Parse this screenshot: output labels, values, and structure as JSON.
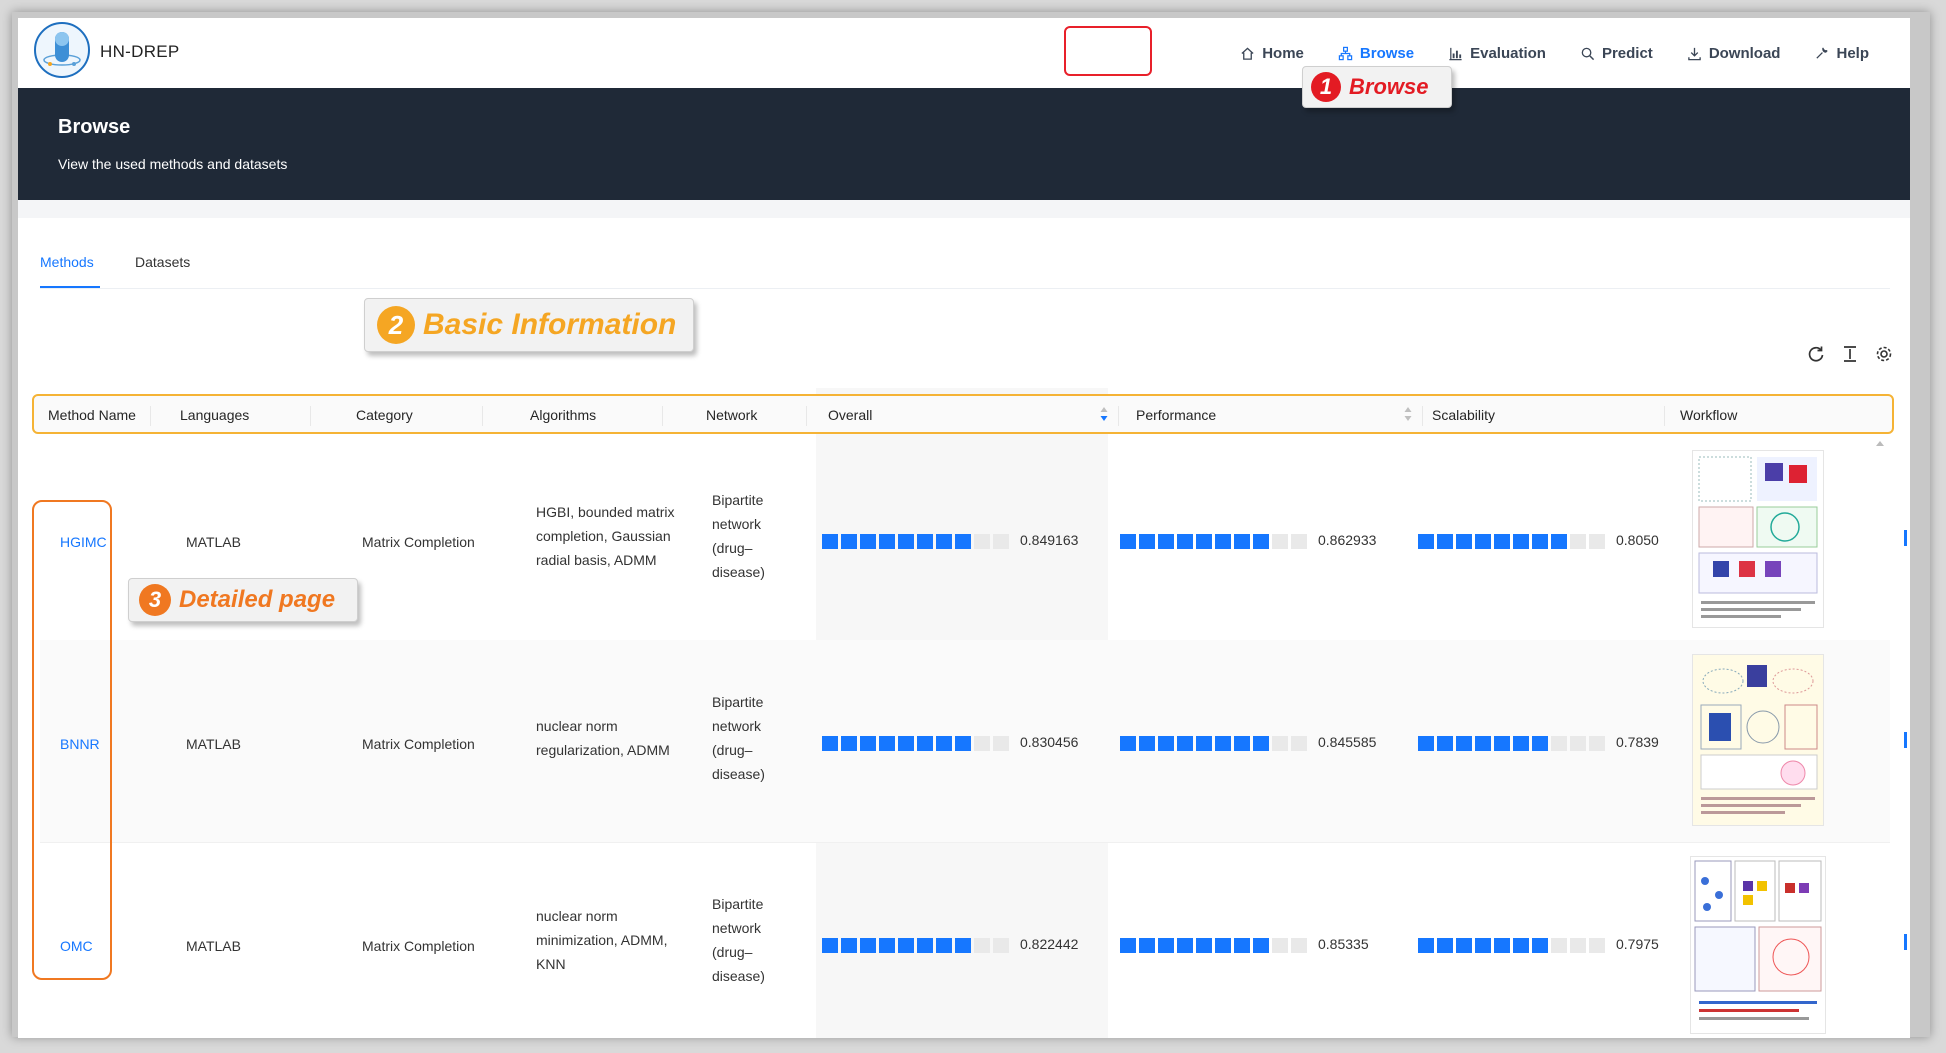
{
  "app": {
    "name": "HN-DREP"
  },
  "nav": [
    {
      "label": "Home",
      "icon": "home-icon"
    },
    {
      "label": "Browse",
      "icon": "sitemap-icon",
      "active": true
    },
    {
      "label": "Evaluation",
      "icon": "bar-chart-icon"
    },
    {
      "label": "Predict",
      "icon": "search-icon"
    },
    {
      "label": "Download",
      "icon": "download-icon"
    },
    {
      "label": "Help",
      "icon": "tool-icon"
    }
  ],
  "hero": {
    "title": "Browse",
    "subtitle": "View the used methods and datasets"
  },
  "callouts": [
    {
      "number": "1",
      "text": "Browse"
    },
    {
      "number": "2",
      "text": "Basic Information"
    },
    {
      "number": "3",
      "text": "Detailed page"
    }
  ],
  "tabs": [
    {
      "label": "Methods",
      "active": true
    },
    {
      "label": "Datasets"
    }
  ],
  "table": {
    "columns": [
      "Method Name",
      "Languages",
      "Category",
      "Algorithms",
      "Network",
      "Overall",
      "Performance",
      "Scalability",
      "Workflow"
    ],
    "rows": [
      {
        "name": "HGIMC",
        "language": "MATLAB",
        "category": "Matrix Completion",
        "algorithms": [
          "HGBI, bounded matrix",
          "completion, Gaussian",
          "radial basis, ADMM"
        ],
        "network": [
          "Bipartite",
          "network",
          "(drug–",
          "disease)"
        ],
        "overall": "0.849163",
        "performance": "0.862933",
        "scalability": "0.8050",
        "overall_frac": 0.849163,
        "performance_frac": 0.862933,
        "scalability_frac": 0.805
      },
      {
        "name": "BNNR",
        "language": "MATLAB",
        "category": "Matrix Completion",
        "algorithms": [
          "nuclear norm",
          "regularization, ADMM"
        ],
        "network": [
          "Bipartite",
          "network",
          "(drug–",
          "disease)"
        ],
        "overall": "0.830456",
        "performance": "0.845585",
        "scalability": "0.7839",
        "overall_frac": 0.830456,
        "performance_frac": 0.845585,
        "scalability_frac": 0.7839
      },
      {
        "name": "OMC",
        "language": "MATLAB",
        "category": "Matrix Completion",
        "algorithms": [
          "nuclear norm",
          "minimization, ADMM,",
          "KNN"
        ],
        "network": [
          "Bipartite",
          "network",
          "(drug–",
          "disease)"
        ],
        "overall": "0.822442",
        "performance": "0.85335",
        "scalability": "0.7975",
        "overall_frac": 0.822442,
        "performance_frac": 0.85335,
        "scalability_frac": 0.7975
      }
    ]
  },
  "colors": {
    "accent": "#1677ff",
    "hero_bg": "#1f2937",
    "red_callout": "#e31b23",
    "orange_callout": "#f5a623"
  }
}
